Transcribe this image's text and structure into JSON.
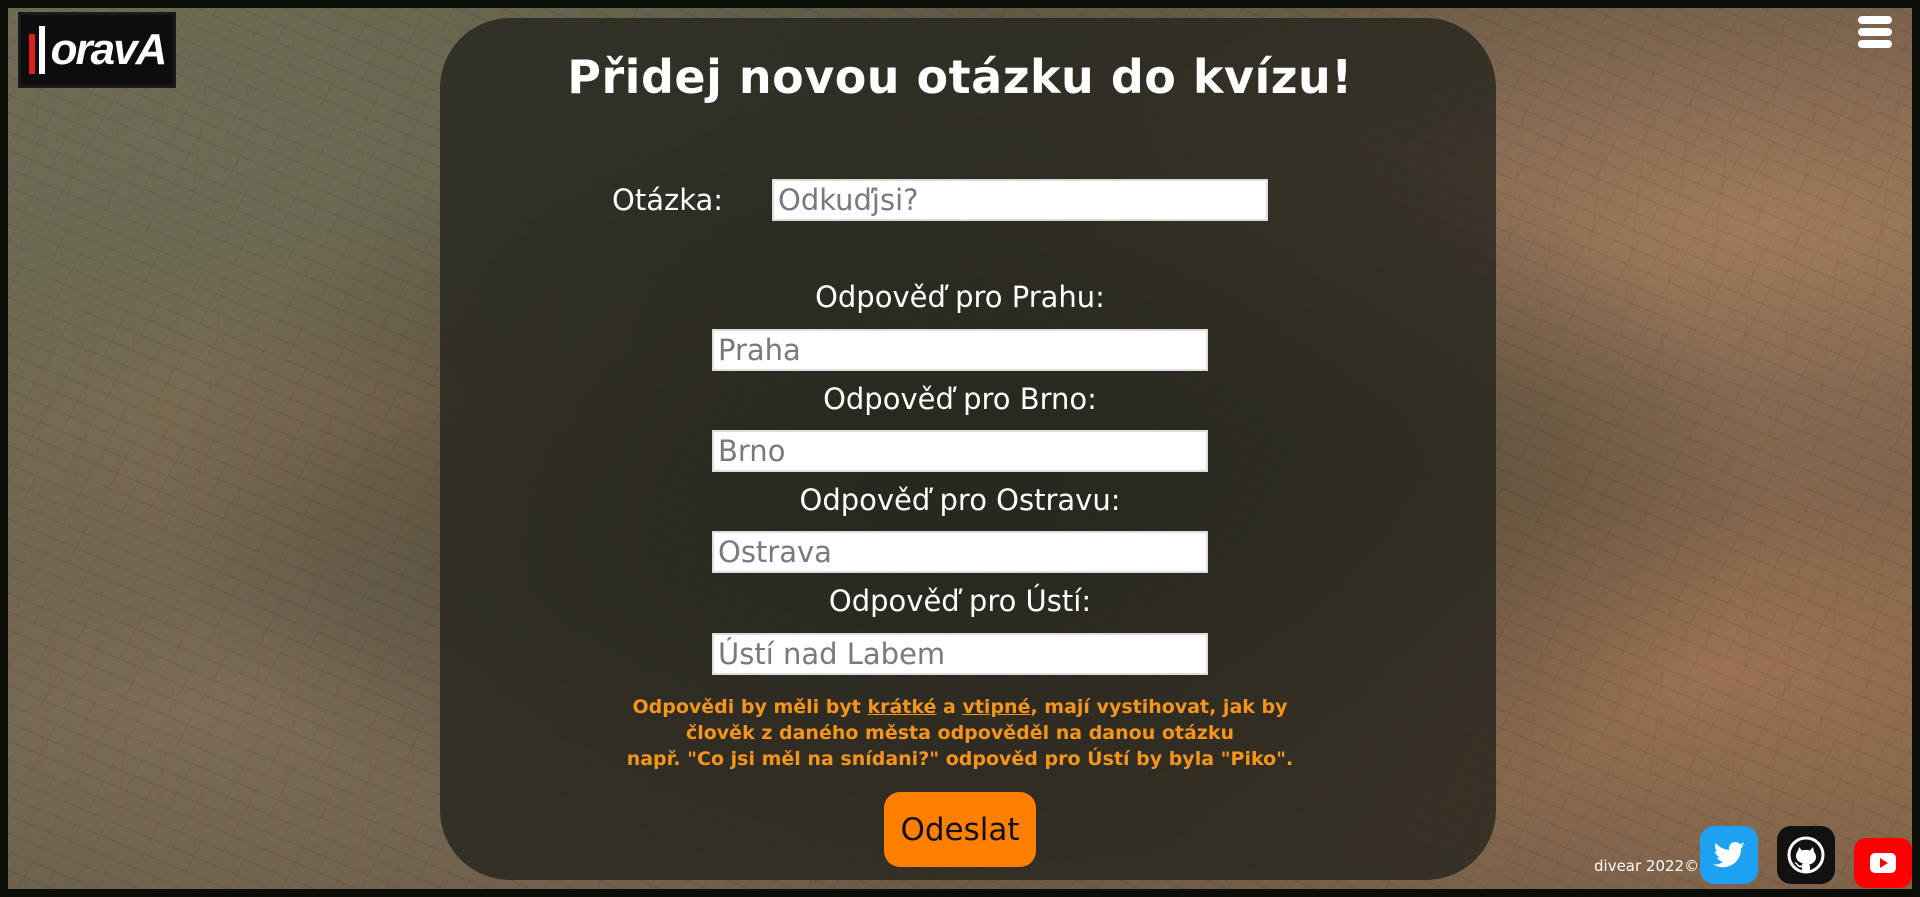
{
  "header": {
    "logo_text": "oravA",
    "menu_icon": "hamburger-icon"
  },
  "form": {
    "title": "Přidej novou otázku do kvízu!",
    "question_label": "Otázka:",
    "question_placeholder": "Odkuďjsi?",
    "answers": [
      {
        "label": "Odpověď pro Prahu:",
        "placeholder": "Praha"
      },
      {
        "label": "Odpověď pro Brno:",
        "placeholder": "Brno"
      },
      {
        "label": "Odpověď pro Ostravu:",
        "placeholder": "Ostrava"
      },
      {
        "label": "Odpověď pro Ústí:",
        "placeholder": "Ústí nad Labem"
      }
    ],
    "note": {
      "prefix": "Odpovědi by měli byt ",
      "word1": "krátké",
      "middle": " a ",
      "word2": "vtipné",
      "suffix": ", mají vystihovat, jak by",
      "line2": "člověk z daného města odpověděl na danou otázku",
      "line3": "např. \"Co jsi měl na snídani?\" odpověd pro Ústí by byla \"Piko\"."
    },
    "submit_label": "Odeslat"
  },
  "footer": {
    "copyright": "divear 2022©",
    "social": [
      {
        "name": "twitter",
        "icon": "twitter-icon",
        "color": "#1da1f2"
      },
      {
        "name": "github",
        "icon": "github-icon",
        "color": "#111111"
      },
      {
        "name": "youtube",
        "icon": "youtube-icon",
        "color": "#ff0000"
      }
    ]
  },
  "colors": {
    "accent": "#ff7f00",
    "note_text": "#f7941d",
    "panel": "rgba(35,35,28,0.78)"
  }
}
